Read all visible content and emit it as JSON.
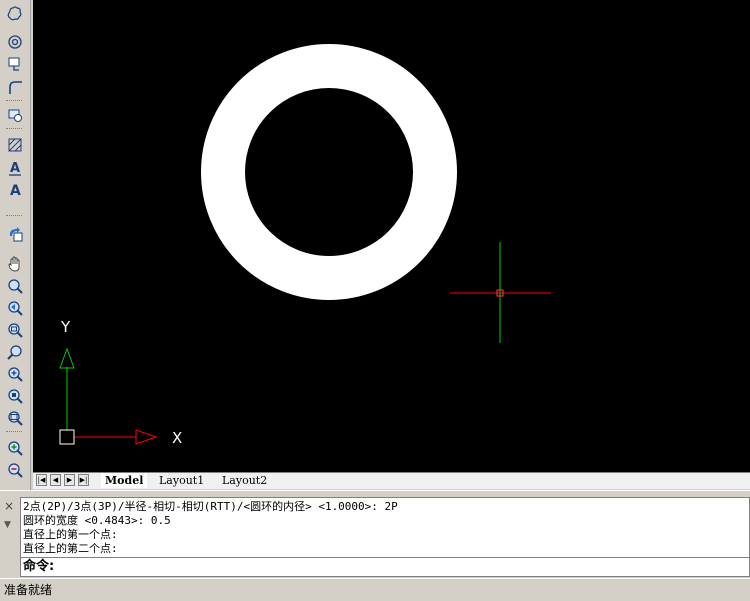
{
  "toolbar": {
    "icons": [
      "revision-cloud-icon",
      "donut-icon",
      "leader-icon",
      "fillet-icon",
      "wipeout-icon",
      "hatch-icon",
      "text-underline-icon",
      "text-icon",
      "regen-icon",
      "pan-hand-icon",
      "zoom-realtime-icon",
      "zoom-previous-icon",
      "zoom-window-icon",
      "zoom-dynamic-icon",
      "zoom-in-icon",
      "zoom-extents-icon",
      "zoom-all-icon",
      "zoom-plus-icon",
      "zoom-minus-icon"
    ]
  },
  "drawing": {
    "background": "#000000",
    "ring_color": "#ffffff",
    "crosshair_x_color": "#ff0000",
    "crosshair_y_color": "#00cc00",
    "ucs": {
      "x_label": "X",
      "y_label": "Y",
      "x_color": "#ff0000",
      "y_color": "#00cc00"
    }
  },
  "tabs": {
    "model": "Model",
    "layout1": "Layout1",
    "layout2": "Layout2"
  },
  "command": {
    "history": [
      "2点(2P)/3点(3P)/半径-相切-相切(RTT)/<圆环的内径> <1.0000>: 2P",
      "圆环的宽度 <0.4843>: 0.5",
      "直径上的第一个点:",
      "直径上的第二个点:"
    ],
    "prompt": "命令:",
    "input_value": ""
  },
  "status": {
    "text": "准备就绪"
  }
}
